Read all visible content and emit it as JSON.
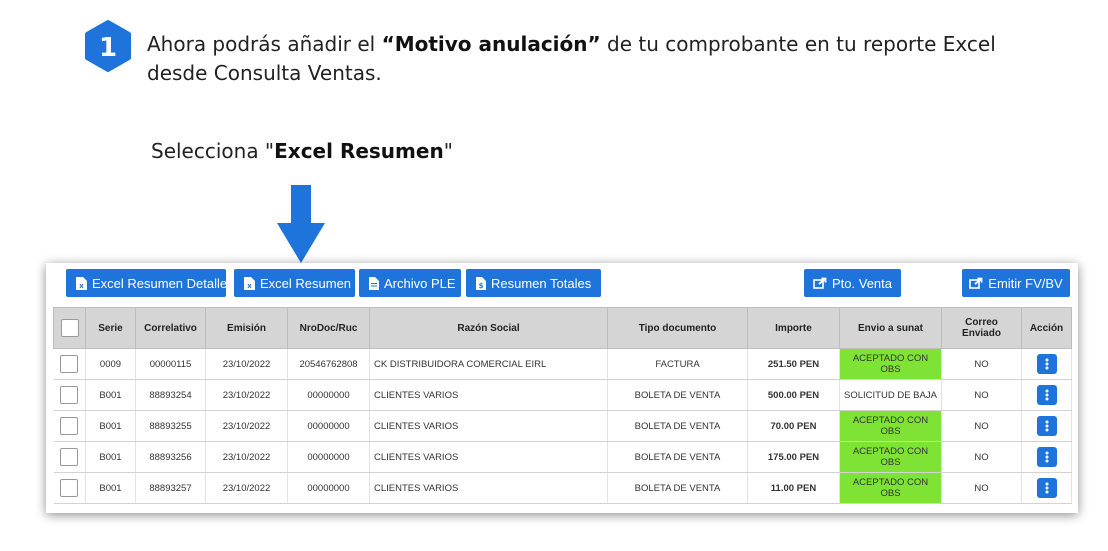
{
  "step": {
    "number": "1",
    "line1_pre": "Ahora podrás añadir el ",
    "line1_bold": "“Motivo anulación”",
    "line1_post": " de tu comprobante en tu reporte Excel",
    "line2": "desde Consulta Ventas."
  },
  "instruction": {
    "pre": "Selecciona \"",
    "bold": "Excel Resumen",
    "post": "\""
  },
  "colors": {
    "accent": "#1f74db",
    "status_ok": "#7ee335",
    "header_bg": "#d5d5d5"
  },
  "toolbar": {
    "excel_detalle": "Excel Resumen Detalle",
    "excel_resumen": "Excel Resumen",
    "archivo_ple": "Archivo PLE",
    "resumen_totales": "Resumen Totales",
    "pto_venta": "Pto. Venta",
    "emitir": "Emitir FV/BV"
  },
  "table": {
    "headers": {
      "serie": "Serie",
      "correlativo": "Correlativo",
      "emision": "Emisión",
      "nrodoc": "NroDoc/Ruc",
      "razon": "Razón Social",
      "tipo": "Tipo documento",
      "importe": "Importe",
      "envio": "Envio a sunat",
      "correo_1": "Correo",
      "correo_2": "Enviado",
      "accion": "Acción"
    },
    "rows": [
      {
        "serie": "0009",
        "correlativo": "00000115",
        "emision": "23/10/2022",
        "nrodoc": "20546762808",
        "razon": "CK DISTRIBUIDORA COMERCIAL EIRL",
        "tipo": "FACTURA",
        "importe": "251.50 PEN",
        "envio": "ACEPTADO CON OBS",
        "correo": "NO"
      },
      {
        "serie": "B001",
        "correlativo": "88893254",
        "emision": "23/10/2022",
        "nrodoc": "00000000",
        "razon": "CLIENTES VARIOS",
        "tipo": "BOLETA DE VENTA",
        "importe": "500.00 PEN",
        "envio": "SOLICITUD DE BAJA",
        "correo": "NO"
      },
      {
        "serie": "B001",
        "correlativo": "88893255",
        "emision": "23/10/2022",
        "nrodoc": "00000000",
        "razon": "CLIENTES VARIOS",
        "tipo": "BOLETA DE VENTA",
        "importe": "70.00 PEN",
        "envio": "ACEPTADO CON OBS",
        "correo": "NO"
      },
      {
        "serie": "B001",
        "correlativo": "88893256",
        "emision": "23/10/2022",
        "nrodoc": "00000000",
        "razon": "CLIENTES VARIOS",
        "tipo": "BOLETA DE VENTA",
        "importe": "175.00 PEN",
        "envio": "ACEPTADO CON OBS",
        "correo": "NO"
      },
      {
        "serie": "B001",
        "correlativo": "88893257",
        "emision": "23/10/2022",
        "nrodoc": "00000000",
        "razon": "CLIENTES VARIOS",
        "tipo": "BOLETA DE VENTA",
        "importe": "11.00 PEN",
        "envio": "ACEPTADO CON OBS",
        "correo": "NO"
      }
    ]
  }
}
